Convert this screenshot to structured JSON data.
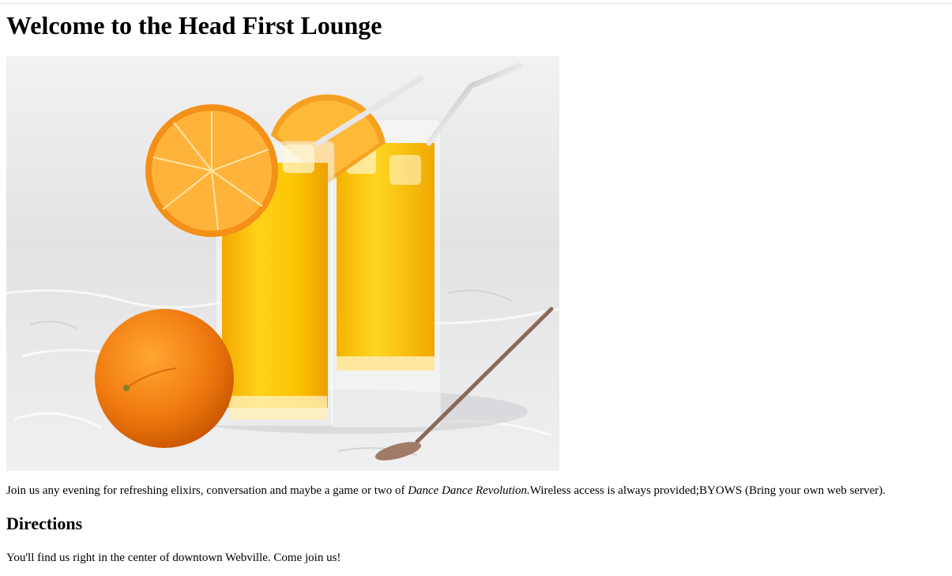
{
  "page": {
    "heading": "Welcome to the Head First Lounge",
    "intro": {
      "before": "Join us any evening for refreshing elixirs, conversation and maybe a game or two of ",
      "emphasis": "Dance Dance Revolution.",
      "after": "Wireless access is always provided;BYOWS (Bring your own web server)."
    },
    "directions_heading": "Directions",
    "directions_text": "You'll find us right in the center of downtown Webville. Come join us!"
  },
  "hero_image": {
    "subject": "two glasses of orange drink with metal straws, orange slices, whole orange and bar spoon"
  },
  "colors": {
    "background": "#ffffff",
    "text": "#000000",
    "top_rule": "#e4e4e4",
    "juice": "#f5b800",
    "orange": "#f07a10",
    "wall": "#ececec",
    "table": "#e6e6e6"
  }
}
